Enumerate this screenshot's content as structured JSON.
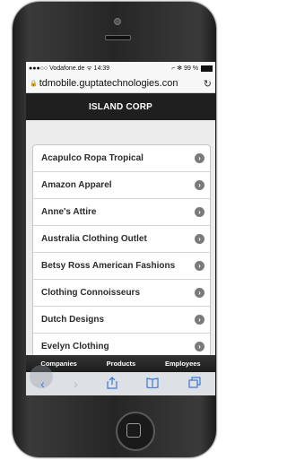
{
  "status": {
    "left": "●●●○○ Vodafone.de ᯤ 14:39",
    "right": "⌐ ✻ 99 %"
  },
  "browser": {
    "url": "tdmobile.guptatechnologies.con"
  },
  "header": {
    "title": "ISLAND CORP"
  },
  "list": {
    "items": [
      "Acapulco Ropa Tropical",
      "Amazon Apparel",
      "Anne's Attire",
      "Australia Clothing Outlet",
      "Betsy Ross American Fashions",
      "Clothing Connoisseurs",
      "Dutch Designs",
      "Evelyn Clothing"
    ]
  },
  "tabs": [
    "Companies",
    "Products",
    "Employees"
  ],
  "toolbar": {
    "icons": [
      "back-icon",
      "forward-icon",
      "share-icon",
      "bookmarks-icon",
      "tabs-icon"
    ]
  }
}
